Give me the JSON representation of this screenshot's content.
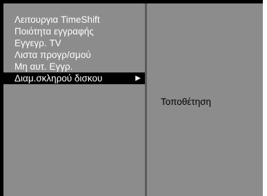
{
  "menu": {
    "items": [
      {
        "label": "Λειτουργια TimeShift"
      },
      {
        "label": "Ποιότητα εγγραφής"
      },
      {
        "label": "Εγγεγρ. TV"
      },
      {
        "label": "Λιστα προγρ/σμού"
      },
      {
        "label": "Μη αυτ. Εγγρ."
      },
      {
        "label": "Διαμ.σκληρού δισκου",
        "selected": true,
        "arrow": "▶"
      }
    ]
  },
  "submenu": {
    "items": [
      {
        "label": "Τοποθέτηση"
      }
    ]
  },
  "colors": {
    "frame": "#000000",
    "panel": "#8c8c8c",
    "divider": "#5a5a5a",
    "highlight": "#000000",
    "menu_text": "#ffffff",
    "submenu_text": "#000000"
  }
}
